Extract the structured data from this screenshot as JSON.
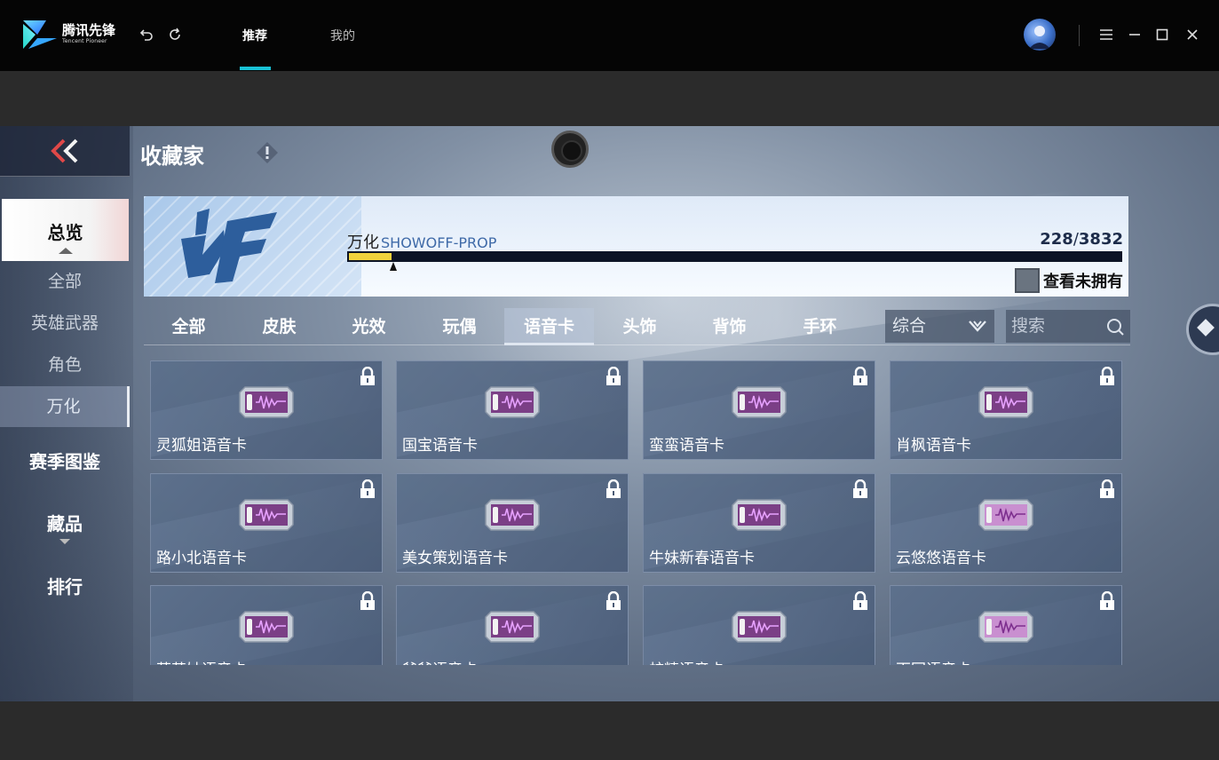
{
  "app": {
    "brand_cn": "腾讯先锋",
    "brand_en": "Tencent Pioneer",
    "icons": {
      "back": "back-icon",
      "refresh": "refresh-icon",
      "menu": "menu-icon",
      "minimize": "minimize-icon",
      "maximize": "maximize-icon",
      "close": "close-icon"
    },
    "tabs": [
      {
        "label": "推荐",
        "active": true
      },
      {
        "label": "我的",
        "active": false
      }
    ],
    "accent": "#19c2d6"
  },
  "game": {
    "page_title": "收藏家",
    "nav": {
      "overview": "总览",
      "subitems": [
        {
          "label": "全部",
          "active": false
        },
        {
          "label": "英雄武器",
          "active": false
        },
        {
          "label": "角色",
          "active": false
        },
        {
          "label": "万化",
          "active": true
        }
      ],
      "main": [
        "赛季图鉴",
        "藏品",
        "排行"
      ]
    },
    "collection": {
      "name_cn": "万化",
      "name_en": "SHOWOFF-PROP",
      "owned": "228",
      "total": "3832",
      "progress_fraction": 0.0595,
      "unowned_label": "查看未拥有"
    },
    "categories": [
      {
        "label": "全部",
        "active": false
      },
      {
        "label": "皮肤",
        "active": false
      },
      {
        "label": "光效",
        "active": false
      },
      {
        "label": "玩偶",
        "active": false
      },
      {
        "label": "语音卡",
        "active": true
      },
      {
        "label": "头饰",
        "active": false
      },
      {
        "label": "背饰",
        "active": false
      },
      {
        "label": "手环",
        "active": false
      }
    ],
    "sort": {
      "selected": "综合"
    },
    "search": {
      "placeholder": "搜索"
    },
    "items": [
      {
        "name": "灵狐姐语音卡",
        "locked": true,
        "style": "purple"
      },
      {
        "name": "国宝语音卡",
        "locked": true,
        "style": "purple"
      },
      {
        "name": "蛮蛮语音卡",
        "locked": true,
        "style": "purple"
      },
      {
        "name": "肖枫语音卡",
        "locked": true,
        "style": "purple"
      },
      {
        "name": "路小北语音卡",
        "locked": true,
        "style": "purple"
      },
      {
        "name": "美女策划语音卡",
        "locked": true,
        "style": "purple"
      },
      {
        "name": "牛妹新春语音卡",
        "locked": true,
        "style": "purple"
      },
      {
        "name": "云悠悠语音卡",
        "locked": true,
        "style": "pink"
      },
      {
        "name": "落英姑语音卡",
        "locked": true,
        "style": "purple"
      },
      {
        "name": "爷爷语音卡",
        "locked": true,
        "style": "purple"
      },
      {
        "name": "蛇精语音卡",
        "locked": true,
        "style": "purple"
      },
      {
        "name": "百回语音卡",
        "locked": true,
        "style": "pink"
      }
    ]
  }
}
